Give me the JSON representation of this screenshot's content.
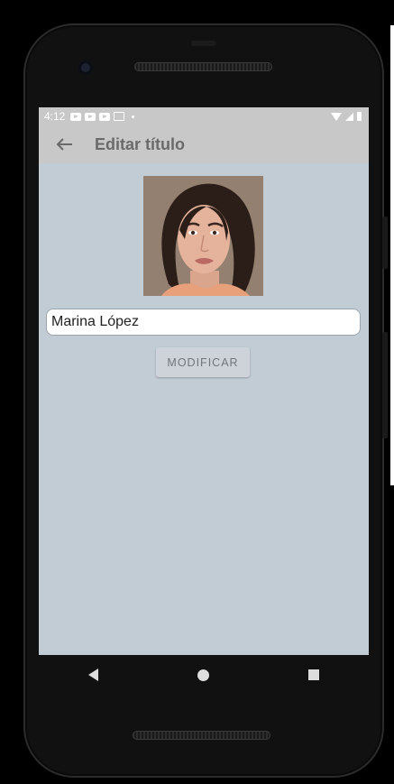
{
  "status_bar": {
    "time": "4:12",
    "icons_left": [
      "youtube-icon",
      "youtube-icon",
      "youtube-icon",
      "gallery-icon",
      "dot-icon"
    ],
    "icons_right": [
      "wifi-icon",
      "signal-icon",
      "battery-icon"
    ]
  },
  "app_bar": {
    "title": "Editar título",
    "back_icon": "arrow-left-icon"
  },
  "profile": {
    "image": "portrait-photo"
  },
  "form": {
    "name_value": "Marina López",
    "modify_label": "MODIFICAR"
  },
  "nav": {
    "back": "nav-back-icon",
    "home": "nav-home-icon",
    "recent": "nav-recent-icon"
  },
  "colors": {
    "screen_bg": "#c2ccd5",
    "app_bar_bg": "#c8c8c8",
    "title_color": "#6a6a6a",
    "button_bg": "#cdd3d9"
  }
}
